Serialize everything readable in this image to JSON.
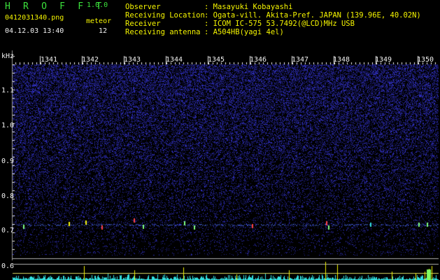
{
  "header": {
    "app_title": "H R O F F T",
    "app_version": "1.0.0",
    "file_name": "0412031340.png",
    "datetime": "04.12.03 13:40",
    "meteor_label": "meteor",
    "meteor_count": "12"
  },
  "info": [
    {
      "key": "Observer",
      "value": ": Masayuki Kobayashi"
    },
    {
      "key": "Receiving Location",
      "value": ": Ogata-vill. Akita-Pref. JAPAN (139.96E, 40.02N)"
    },
    {
      "key": "Receiver",
      "value": ": ICOM IC-575 53.7492(@LCD)MHz USB"
    },
    {
      "key": "Receiving antenna",
      "value": ": A504HB(yagi 4el)"
    }
  ],
  "axis": {
    "unit": "kHz",
    "y_ticks": [
      "1.1",
      "1.0",
      "0.9",
      "0.8",
      "0.7",
      "0.6"
    ],
    "time_ticks": [
      "1341",
      "1342",
      "1343",
      "1344",
      "1345",
      "1346",
      "1347",
      "1348",
      "1349",
      "1350"
    ]
  },
  "colors": {
    "background": "#000000",
    "noise": "#2a2aa8",
    "text_green": "#3ce13c",
    "text_yellow": "#f5f500",
    "trace_cyan": "#33e0e0",
    "spike_yellow": "#f5f500"
  }
}
